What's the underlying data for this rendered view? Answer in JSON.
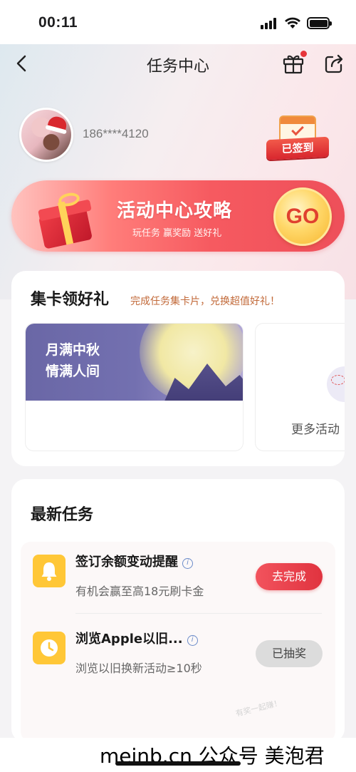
{
  "status_bar": {
    "time": "00:11"
  },
  "nav": {
    "title": "任务中心"
  },
  "user": {
    "phone": "186****4120",
    "signed_label": "已签到"
  },
  "banner": {
    "title": "活动中心攻略",
    "subtitle": "玩任务 赢奖励 送好礼",
    "go_label": "GO"
  },
  "collect_cards": {
    "title": "集卡领好礼",
    "subtitle": "完成任务集卡片，兑换超值好礼！",
    "activity_line1": "月满中秋",
    "activity_line2": "情满人间",
    "more_label": "更多活动"
  },
  "tasks": {
    "title": "最新任务",
    "items": [
      {
        "name": "签订余额变动提醒",
        "desc": "有机会赢至高18元刷卡金",
        "button": "去完成",
        "icon": "bell-icon"
      },
      {
        "name": "浏览Apple以旧...",
        "desc": "浏览以旧换新活动≥10秒",
        "button": "已抽奖",
        "icon": "clock-icon"
      }
    ]
  },
  "watermark": "有奖一起赚！",
  "footer": {
    "caption": "meinb.cn 公众号 美泡君"
  },
  "colors": {
    "accent_red": "#e0333f",
    "icon_yellow": "#ffc737",
    "banner_red": "#f65a60"
  }
}
